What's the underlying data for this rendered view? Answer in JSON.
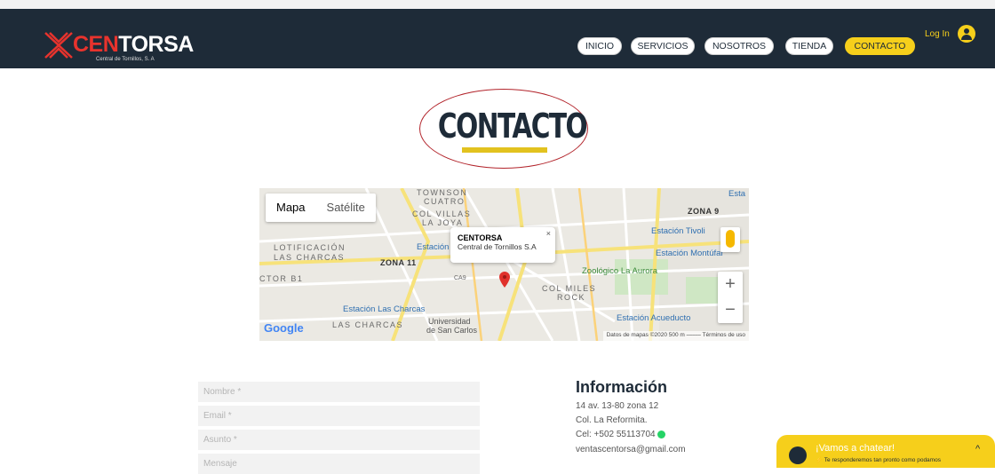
{
  "brand": {
    "logo_red": "CEN",
    "logo_white": "TORSA",
    "logo_sub": "Central de Tornillos, S. A",
    "colors": {
      "header_bg": "#1e2b38",
      "accent_yellow": "#f6cf1b",
      "logo_red": "#e8332d"
    }
  },
  "nav": {
    "items": [
      {
        "label": "INICIO",
        "active": false
      },
      {
        "label": "SERVICIOS",
        "active": false
      },
      {
        "label": "NOSOTROS",
        "active": false
      },
      {
        "label": "TIENDA",
        "active": false
      },
      {
        "label": "CONTACTO",
        "active": true
      }
    ],
    "login_label": "Log In"
  },
  "page": {
    "title": "CONTACTO"
  },
  "map": {
    "tab_map": "Mapa",
    "tab_satellite": "Satélite",
    "popup_title": "CENTORSA",
    "popup_sub": "Central de Tornillos S.A",
    "popup_close": "×",
    "zoom_in": "+",
    "zoom_out": "−",
    "google": "Google",
    "attribution": "Datos de mapas ©2020   500 m ⎯⎯⎯⎯⎯    Términos de uso",
    "labels": {
      "townson": "TOWNSON",
      "cuatro": "CUATRO",
      "col_villas": "COL VILLAS",
      "la_joya": "LA JOYA",
      "lotificacion": "LOTIFICACIÓN",
      "las_charcas_top": "LAS CHARCAS",
      "zona11": "ZONA 11",
      "ctor": "CTOR B1",
      "zona9": "ZONA 9",
      "estacion_tivoli": "Estación Tivoli",
      "estacion_montufar": "Estación Montúfar",
      "zoologico": "Zoológico La Aurora",
      "col_miles": "COL MILES",
      "rock": "ROCK",
      "estacion_las_charcas": "Estación Las Charcas",
      "las_charcas_bottom": "LAS CHARCAS",
      "universidad": "Universidad",
      "de_san_carlos": "de San Carlos",
      "estacion_acueducto": "Estación Acueducto",
      "estacion_left": "Estación",
      "ca9": "CA9",
      "esta": "Esta"
    }
  },
  "form": {
    "name_placeholder": "Nombre *",
    "email_placeholder": "Email *",
    "subject_placeholder": "Asunto *",
    "message_placeholder": "Mensaje"
  },
  "info": {
    "title": "Información",
    "address1": "14 av. 13-80 zona 12",
    "address2": "Col. La Reformita.",
    "phone": "Cel: +502 55113704",
    "email": "ventascentorsa@gmail.com"
  },
  "chat": {
    "title": "¡Vamos a chatear!",
    "subtitle": "Te responderemos tan pronto como podamos",
    "chevron": "^"
  }
}
